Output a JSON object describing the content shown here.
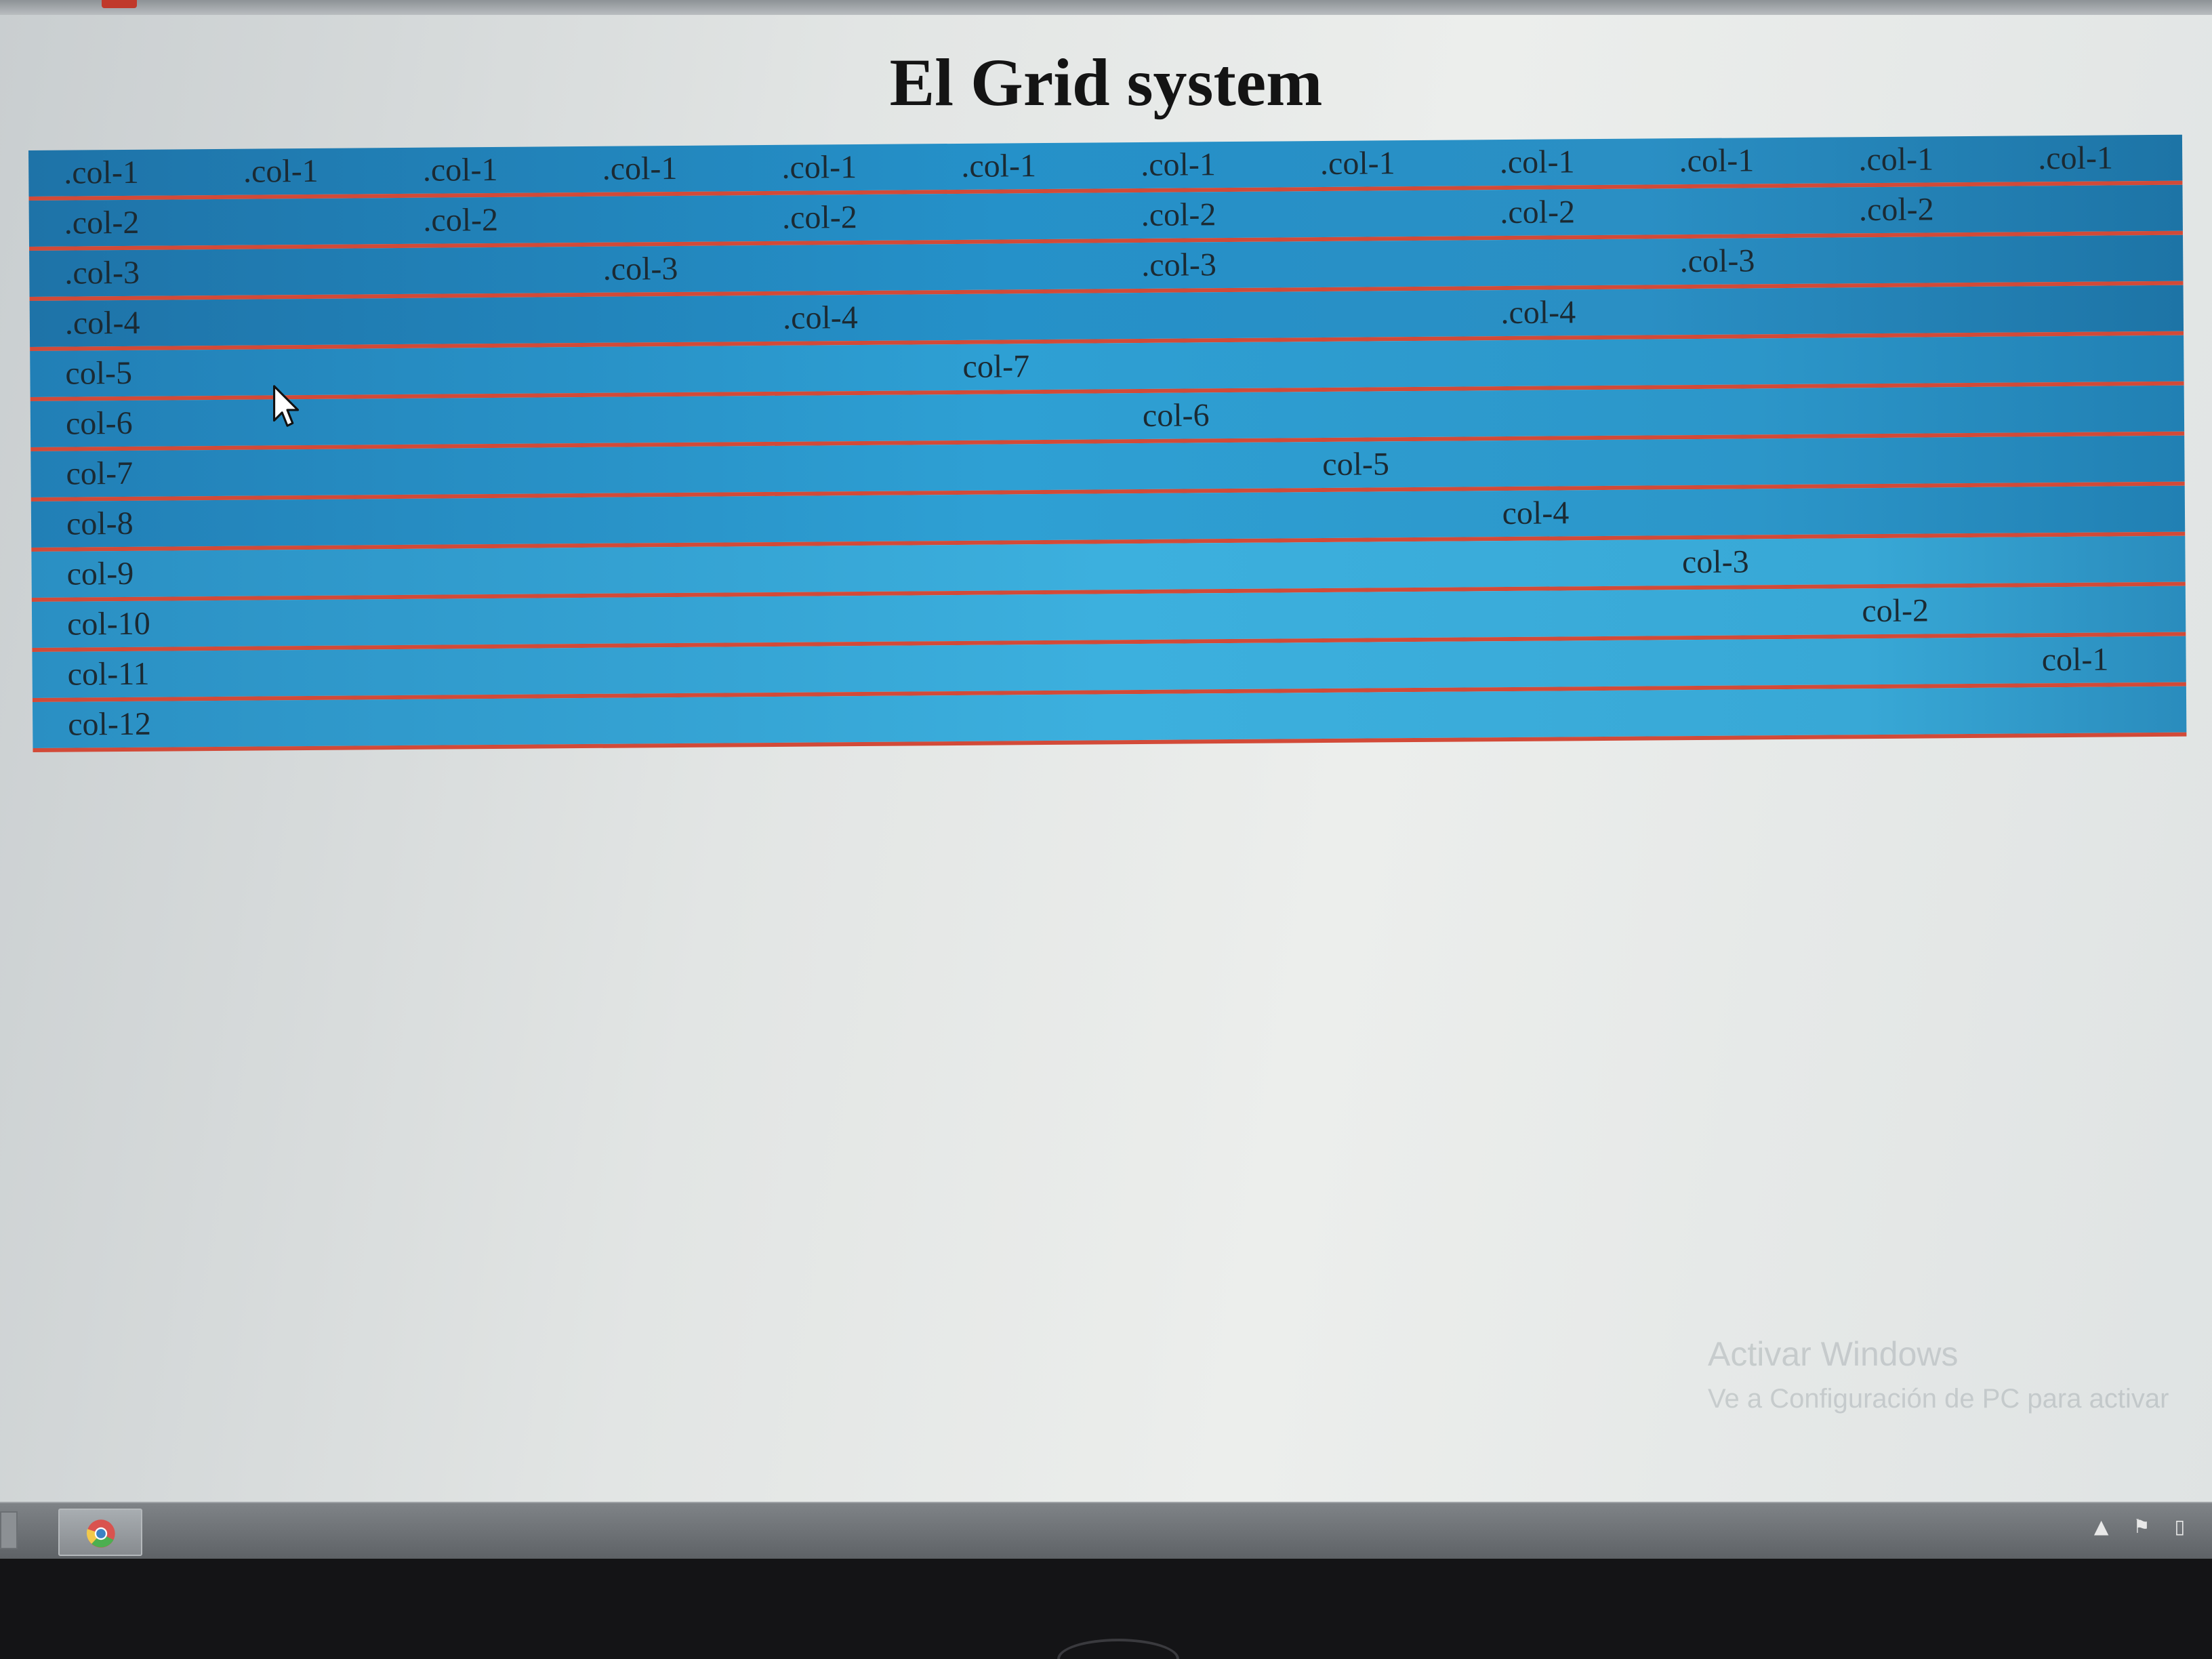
{
  "page": {
    "title": "El Grid system"
  },
  "grid": {
    "rows": [
      {
        "cells": [
          {
            "label": ".col-1",
            "start": 0,
            "span": 1
          },
          {
            "label": ".col-1",
            "start": 1,
            "span": 1
          },
          {
            "label": ".col-1",
            "start": 2,
            "span": 1
          },
          {
            "label": ".col-1",
            "start": 3,
            "span": 1
          },
          {
            "label": ".col-1",
            "start": 4,
            "span": 1
          },
          {
            "label": ".col-1",
            "start": 5,
            "span": 1
          },
          {
            "label": ".col-1",
            "start": 6,
            "span": 1
          },
          {
            "label": ".col-1",
            "start": 7,
            "span": 1
          },
          {
            "label": ".col-1",
            "start": 8,
            "span": 1
          },
          {
            "label": ".col-1",
            "start": 9,
            "span": 1
          },
          {
            "label": ".col-1",
            "start": 10,
            "span": 1
          },
          {
            "label": ".col-1",
            "start": 11,
            "span": 1
          }
        ]
      },
      {
        "cells": [
          {
            "label": ".col-2",
            "start": 0,
            "span": 2
          },
          {
            "label": ".col-2",
            "start": 2,
            "span": 2
          },
          {
            "label": ".col-2",
            "start": 4,
            "span": 2
          },
          {
            "label": ".col-2",
            "start": 6,
            "span": 2
          },
          {
            "label": ".col-2",
            "start": 8,
            "span": 2
          },
          {
            "label": ".col-2",
            "start": 10,
            "span": 2
          }
        ]
      },
      {
        "cells": [
          {
            "label": ".col-3",
            "start": 0,
            "span": 3
          },
          {
            "label": ".col-3",
            "start": 3,
            "span": 3
          },
          {
            "label": ".col-3",
            "start": 6,
            "span": 3
          },
          {
            "label": ".col-3",
            "start": 9,
            "span": 3
          }
        ]
      },
      {
        "cells": [
          {
            "label": ".col-4",
            "start": 0,
            "span": 4
          },
          {
            "label": ".col-4",
            "start": 4,
            "span": 4
          },
          {
            "label": ".col-4",
            "start": 8,
            "span": 4
          }
        ]
      },
      {
        "cells": [
          {
            "label": "col-5",
            "start": 0,
            "span": 5
          },
          {
            "label": "col-7",
            "start": 5,
            "span": 7
          }
        ]
      },
      {
        "cells": [
          {
            "label": "col-6",
            "start": 0,
            "span": 6
          },
          {
            "label": "col-6",
            "start": 6,
            "span": 6
          }
        ]
      },
      {
        "cells": [
          {
            "label": "col-7",
            "start": 0,
            "span": 7
          },
          {
            "label": "col-5",
            "start": 7,
            "span": 5
          }
        ]
      },
      {
        "cells": [
          {
            "label": "col-8",
            "start": 0,
            "span": 8
          },
          {
            "label": "col-4",
            "start": 8,
            "span": 4
          }
        ]
      },
      {
        "cells": [
          {
            "label": "col-9",
            "start": 0,
            "span": 9
          },
          {
            "label": "col-3",
            "start": 9,
            "span": 3
          }
        ]
      },
      {
        "cells": [
          {
            "label": "col-10",
            "start": 0,
            "span": 10
          },
          {
            "label": "col-2",
            "start": 10,
            "span": 2
          }
        ]
      },
      {
        "cells": [
          {
            "label": "col-11",
            "start": 0,
            "span": 11
          },
          {
            "label": "col-1",
            "start": 11,
            "span": 1
          }
        ]
      },
      {
        "cells": [
          {
            "label": "col-12",
            "start": 0,
            "span": 12
          }
        ]
      }
    ]
  },
  "watermark": {
    "line1": "Activar Windows",
    "line2": "Ve a Configuración de PC para activar"
  },
  "taskbar": {
    "pinned": [
      {
        "icon": "chrome-icon"
      }
    ],
    "tray": [
      {
        "icon": "show-hidden-icons-icon",
        "glyph": "▲"
      },
      {
        "icon": "action-center-flag-icon",
        "glyph": "⚑"
      },
      {
        "icon": "battery-icon",
        "glyph": "▯"
      }
    ]
  },
  "colors": {
    "row_blue_dark": "#1e73a8",
    "row_blue_light": "#3cb0de",
    "row_border_red": "#d24a38",
    "title_text": "#141414"
  }
}
